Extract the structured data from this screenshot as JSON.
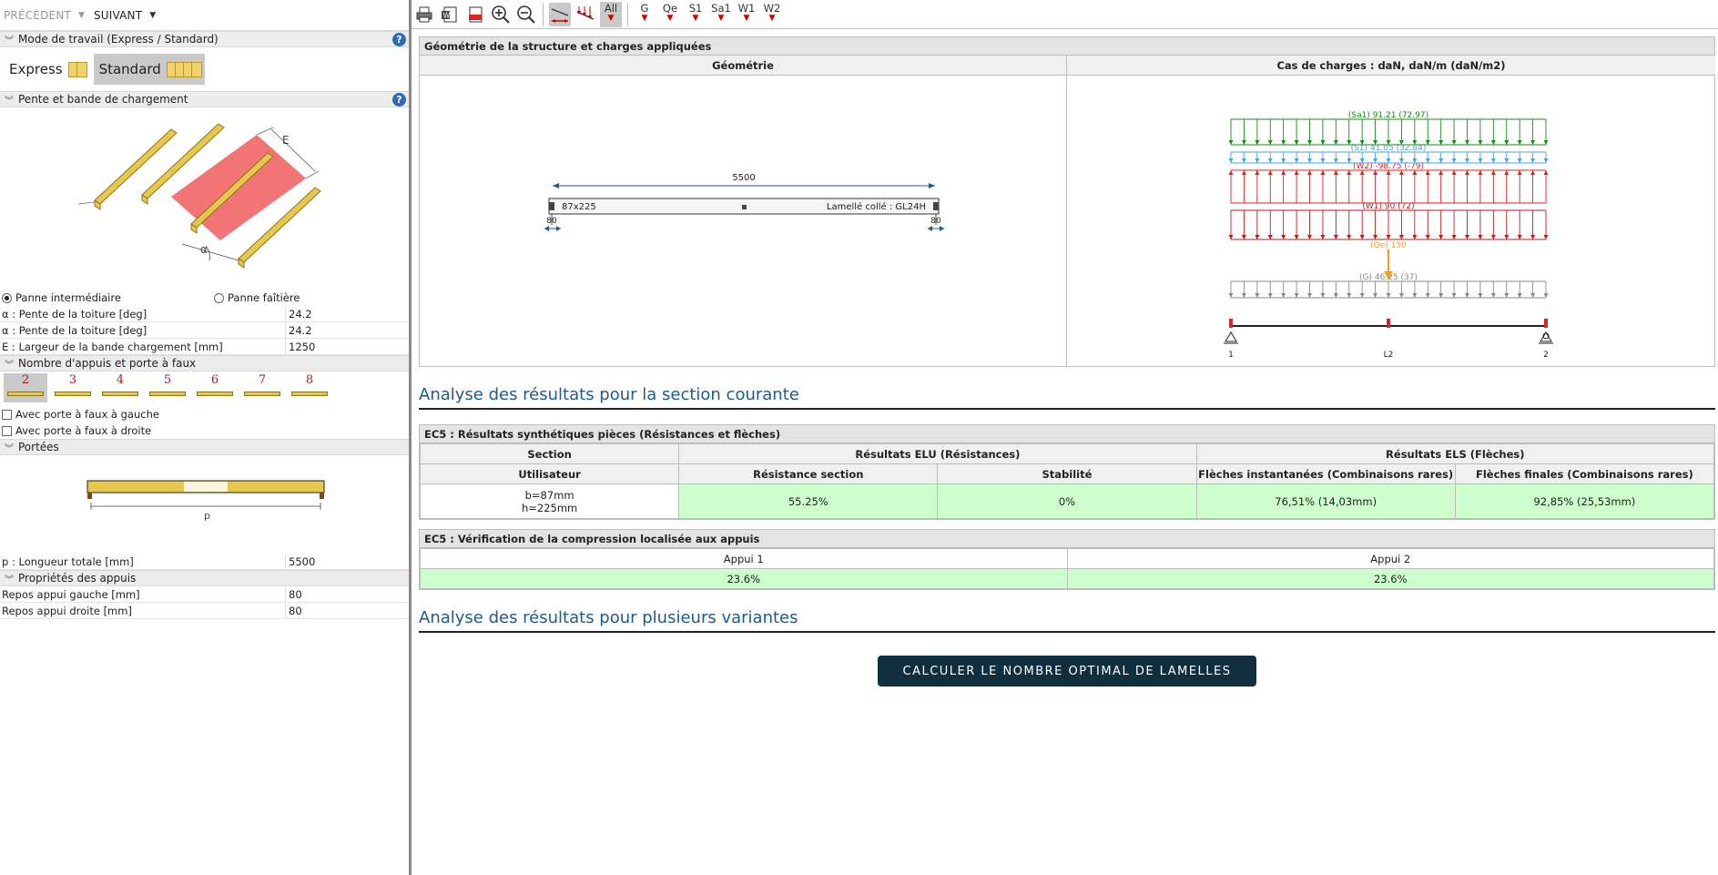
{
  "nav": {
    "prev": "PRÉCÉDENT",
    "next": "SUIVANT"
  },
  "sections": {
    "mode": "Mode de travail (Express / Standard)",
    "pente": "Pente et bande de chargement",
    "appuis": "Nombre d'appuis et porte à faux",
    "portees": "Portées",
    "props_appuis": "Propriétés des appuis"
  },
  "modes": {
    "express": "Express",
    "standard": "Standard"
  },
  "illustration": {
    "label_e": "E",
    "label_alpha": "α"
  },
  "panne": {
    "intermediaire": "Panne intermédiaire",
    "faitiere": "Panne faîtière"
  },
  "props": [
    {
      "label": "α : Pente de la toiture  [deg]",
      "value": "24.2"
    },
    {
      "label": "α : Pente de la toiture  [deg]",
      "value": "24.2"
    },
    {
      "label": "E : Largeur de la bande chargement  [mm]",
      "value": "1250"
    }
  ],
  "support_counts": [
    "2",
    "3",
    "4",
    "5",
    "6",
    "7",
    "8"
  ],
  "portafaux": {
    "gauche": "Avec porte à faux à gauche",
    "droite": "Avec porte à faux à droite"
  },
  "portee": {
    "label_p": "p",
    "longueur_label": "p : Longueur totale  [mm]",
    "longueur_value": "5500"
  },
  "appui_props": [
    {
      "label": "Repos appui gauche  [mm]",
      "value": "80"
    },
    {
      "label": "Repos appui droite  [mm]",
      "value": "80"
    }
  ],
  "toolbar": {
    "all": "All",
    "loads": [
      "G",
      "Qe",
      "S1",
      "Sa1",
      "W1",
      "W2"
    ]
  },
  "geometry_panel": {
    "title": "Géométrie de la structure et charges appliquées",
    "col_geo": "Géométrie",
    "col_loads": "Cas de charges : daN, daN/m (daN/m2)",
    "span": "5500",
    "section": "87x225",
    "material": "Lamellé collé : GL24H",
    "support_left": "80",
    "support_right": "80"
  },
  "load_cases": [
    {
      "label": "(Sa1) 91.21 (72.97)",
      "color": "#1a8a1a"
    },
    {
      "label": "(S1) 41.05 (32.84)",
      "color": "#4aa0e8"
    },
    {
      "label": "(W2) -98.75 (-79)",
      "color": "#e02020"
    },
    {
      "label": "(W1) 90 (72)",
      "color": "#c01818"
    },
    {
      "label": "(Qe) 150",
      "color": "#f0a020"
    },
    {
      "label": "(G) 46.25 (37)",
      "color": "#888888"
    }
  ],
  "load_nodes": [
    "1",
    "L2",
    "2"
  ],
  "results_title": "Analyse des résultats pour la section courante",
  "ec5_res": {
    "title": "EC5 : Résultats synthétiques pièces (Résistances et flèches)",
    "section": "Section",
    "elu": "Résultats ELU (Résistances)",
    "els": "Résultats ELS (Flèches)",
    "utilisateur": "Utilisateur",
    "resistance": "Résistance section",
    "stabilite": "Stabilité",
    "fleche_inst": "Flèches instantanées (Combinaisons rares)",
    "fleche_fin": "Flèches finales (Combinaisons rares)",
    "b": "b=87mm",
    "h": "h=225mm",
    "v_resistance": "55.25%",
    "v_stabilite": "0%",
    "v_inst": "76,51% (14,03mm)",
    "v_fin": "92,85% (25,53mm)"
  },
  "ec5_comp": {
    "title": "EC5 : Vérification de la compression localisée aux appuis",
    "appui1": "Appui 1",
    "appui2": "Appui 2",
    "v1": "23.6%",
    "v2": "23.6%"
  },
  "variants_title": "Analyse des résultats pour plusieurs variantes",
  "button": "CALCULER LE NOMBRE OPTIMAL DE LAMELLES"
}
